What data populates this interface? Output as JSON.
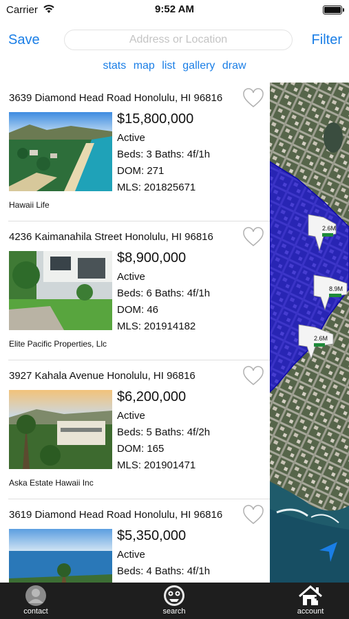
{
  "status_bar": {
    "carrier": "Carrier",
    "time": "9:52 AM"
  },
  "nav": {
    "save_label": "Save",
    "filter_label": "Filter",
    "search_placeholder": "Address or Location"
  },
  "view_links": [
    "stats",
    "map",
    "list",
    "gallery",
    "draw"
  ],
  "listings": [
    {
      "address": "3639 Diamond Head Road Honolulu, HI 96816",
      "price": "$15,800,000",
      "status": "Active",
      "beds_baths": "Beds: 3 Baths: 4f/1h",
      "dom": "DOM: 271",
      "mls": "MLS: 201825671",
      "agency": "Hawaii Life"
    },
    {
      "address": "4236 Kaimanahila Street Honolulu, HI 96816",
      "price": "$8,900,000",
      "status": "Active",
      "beds_baths": "Beds: 6 Baths: 4f/1h",
      "dom": "DOM: 46",
      "mls": "MLS: 201914182",
      "agency": "Elite Pacific Properties, Llc"
    },
    {
      "address": "3927 Kahala Avenue Honolulu, HI 96816",
      "price": "$6,200,000",
      "status": "Active",
      "beds_baths": "Beds: 5 Baths: 4f/2h",
      "dom": "DOM: 165",
      "mls": "MLS: 201901471",
      "agency": "Aska Estate Hawaii Inc"
    },
    {
      "address": "3619 Diamond Head Road Honolulu, HI 96816",
      "price": "$5,350,000",
      "status": "Active",
      "beds_baths": "Beds: 4 Baths: 4f/1h"
    }
  ],
  "map_pins": [
    {
      "label": "2.6M",
      "icon": "house-pin-icon"
    },
    {
      "label": "8.9M",
      "icon": "house-pin-icon"
    },
    {
      "label": "2.6M",
      "icon": "house-pin-icon"
    }
  ],
  "tabbar": {
    "contact": "contact",
    "search": "search",
    "account": "account"
  },
  "colors": {
    "accent": "#1a7ee6",
    "draw_polygon": "#1a10d8",
    "tabbar": "#1e1e1e"
  }
}
